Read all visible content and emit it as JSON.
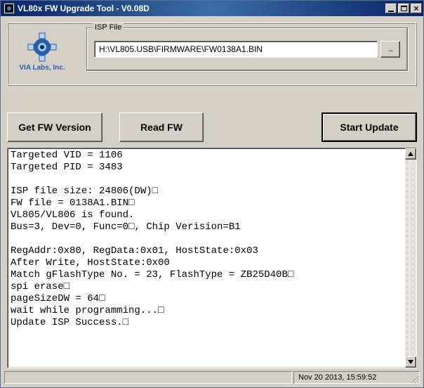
{
  "window": {
    "title": "VL80x FW Upgrade Tool - V0.08D"
  },
  "logo": {
    "label": "VIA Labs, Inc.",
    "accent": "#2a5da8"
  },
  "isp": {
    "group_label": "ISP File",
    "file_path": "H:\\VL805.USB\\FIRMWARE\\FW0138A1.BIN",
    "browse_label": "..."
  },
  "buttons": {
    "get_fw": "Get FW Version",
    "read_fw": "Read FW",
    "start_update": "Start Update"
  },
  "log_lines": "Targeted VID = 1106\nTargeted PID = 3483\n\nISP file size: 24806(DW)□\nFW file = 0138A1.BIN□\nVL805/VL806 is found.\nBus=3, Dev=0, Func=0□, Chip Verision=B1\n\nRegAddr:0x80, RegData:0x01, HostState:0x03\nAfter Write, HostState:0x00\nMatch gFlashType No. = 23, FlashType = ZB25D40B□\nspi erase□\npageSizeDW = 64□\nwait while programming...□\nUpdate ISP Success.□",
  "status": {
    "timestamp": "Nov 20 2013, 15:59:52"
  }
}
